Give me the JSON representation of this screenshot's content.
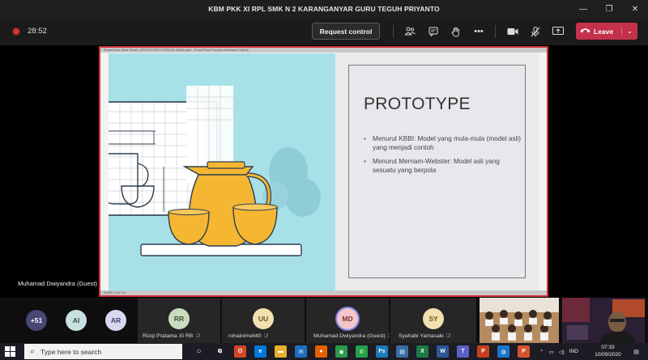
{
  "window": {
    "title": "KBM PKK XI RPL SMK N 2 KARANGANYAR GURU TEGUH PRIYANTO",
    "minimize": "—",
    "maximize": "❐",
    "close": "✕"
  },
  "toolbar": {
    "timer": "28:52",
    "request_control": "Request control",
    "leave": "Leave"
  },
  "share": {
    "presenter_name": "Muhamad Dwiyandra (Guest)",
    "ppt_titlebar": "PowerPoint Slide Show - [PROTOTIPE PRODUK KIMAI.pptx - PowerPoint Product Activation Failed]",
    "ppt_status": "SLIDE 4 OF 15"
  },
  "slide": {
    "title": "PROTOTYPE",
    "bullets": [
      "Menurut KBBI:  Model yang mula-mula (model asli) yang menjadi contoh",
      "Menurut Merriam-Webster: Model asli yang sesuatu yang berpola"
    ]
  },
  "participants": {
    "overflow": "+51",
    "avatars": [
      {
        "initials": "AI",
        "bg": "#c9dfe0",
        "fg": "#2f4f52"
      },
      {
        "initials": "AR",
        "bg": "#d6d9ef",
        "fg": "#3b3f6b"
      }
    ],
    "tiles": [
      {
        "initials": "RR",
        "name": "Rizqi Pratama XI RB",
        "bg": "#c9dcc0",
        "fg": "#3b5133"
      },
      {
        "initials": "UU",
        "name": "rohainimeli40",
        "bg": "#f3e0b0",
        "fg": "#6b5420"
      },
      {
        "initials": "MD",
        "name": "Muhamad Dwiyandra (Guest)",
        "bg": "#f4c6c9",
        "fg": "#7a2f36"
      },
      {
        "initials": "SY",
        "name": "Syahabi Yamasaki",
        "bg": "#f3e0b0",
        "fg": "#6b5420"
      }
    ]
  },
  "taskbar": {
    "search_placeholder": "Type here to search",
    "apps": [
      {
        "name": "task-view-icon",
        "glyph": "⧉",
        "bg": "#1c1c24"
      },
      {
        "name": "office-icon",
        "glyph": "O",
        "bg": "#d24726"
      },
      {
        "name": "edge-icon",
        "glyph": "e",
        "bg": "#0078d7"
      },
      {
        "name": "file-explorer-icon",
        "glyph": "▬",
        "bg": "#e8b02c"
      },
      {
        "name": "mail-icon",
        "glyph": "✉",
        "bg": "#1e6fc1"
      },
      {
        "name": "firefox-icon",
        "glyph": "●",
        "bg": "#e66000"
      },
      {
        "name": "chrome-icon",
        "glyph": "◉",
        "bg": "#2a9a4a"
      },
      {
        "name": "whatsapp-icon",
        "glyph": "✆",
        "bg": "#25a244"
      },
      {
        "name": "fs-icon",
        "glyph": "Fs",
        "bg": "#1d7ab8"
      },
      {
        "name": "files-icon",
        "glyph": "▤",
        "bg": "#3b6ea5"
      },
      {
        "name": "excel-icon",
        "glyph": "X",
        "bg": "#1d7a45"
      },
      {
        "name": "word-icon",
        "glyph": "W",
        "bg": "#2b5797"
      },
      {
        "name": "teams-icon",
        "glyph": "T",
        "bg": "#5b5fc7"
      },
      {
        "name": "powerpoint-icon",
        "glyph": "P",
        "bg": "#c4401d"
      },
      {
        "name": "browser-icon",
        "glyph": "◍",
        "bg": "#1b76c8"
      },
      {
        "name": "ppt-file-icon",
        "glyph": "P",
        "bg": "#d35230"
      }
    ],
    "language": "IND",
    "time": "07:33",
    "date": "10/09/2020"
  }
}
